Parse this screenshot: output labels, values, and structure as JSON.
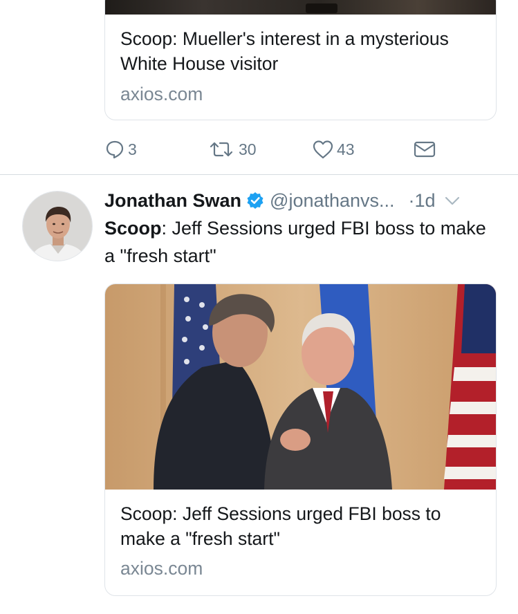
{
  "prev_tweet": {
    "card": {
      "title": "Scoop: Mueller's interest in a mysterious White House visitor",
      "domain": "axios.com"
    },
    "actions": {
      "reply_icon": "reply-icon",
      "reply_count": "3",
      "retweet_icon": "retweet-icon",
      "retweet_count": "30",
      "like_icon": "heart-icon",
      "like_count": "43",
      "dm_icon": "envelope-icon"
    }
  },
  "tweet": {
    "author_name": "Jonathan Swan",
    "verified_icon": "verified-badge-icon",
    "handle": "@jonathanvs...",
    "time": "·1d",
    "menu_icon": "chevron-down-icon",
    "text_bold": "Scoop",
    "text_rest": ": Jeff Sessions urged FBI boss to make a \"fresh start\"",
    "card": {
      "title": "Scoop: Jeff Sessions urged FBI boss to make a \"fresh start\"",
      "domain": "axios.com"
    }
  },
  "colors": {
    "accent": "#1da1f2",
    "secondary_text": "#657786",
    "border": "#dfe3e8"
  }
}
